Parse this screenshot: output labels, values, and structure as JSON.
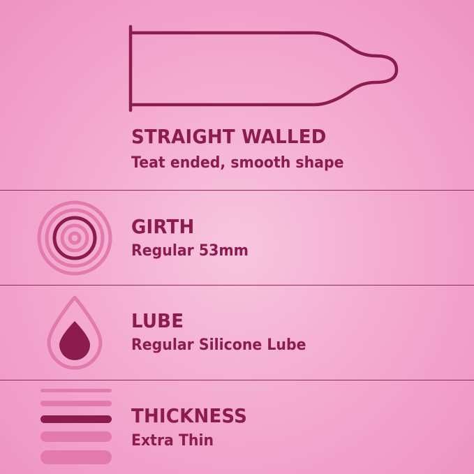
{
  "colors": {
    "accent": "#8c1c4d",
    "icon_light": "#e27aac",
    "background": "#f4acd0"
  },
  "features": [
    {
      "icon": "condom-outline-icon",
      "title": "STRAIGHT WALLED",
      "description": "Teat ended, smooth shape"
    },
    {
      "icon": "concentric-circles-icon",
      "title": "GIRTH",
      "description": "Regular 53mm"
    },
    {
      "icon": "droplet-icon",
      "title": "LUBE",
      "description": "Regular Silicone Lube"
    },
    {
      "icon": "thickness-bars-icon",
      "title": "THICKNESS",
      "description": "Extra Thin"
    }
  ]
}
